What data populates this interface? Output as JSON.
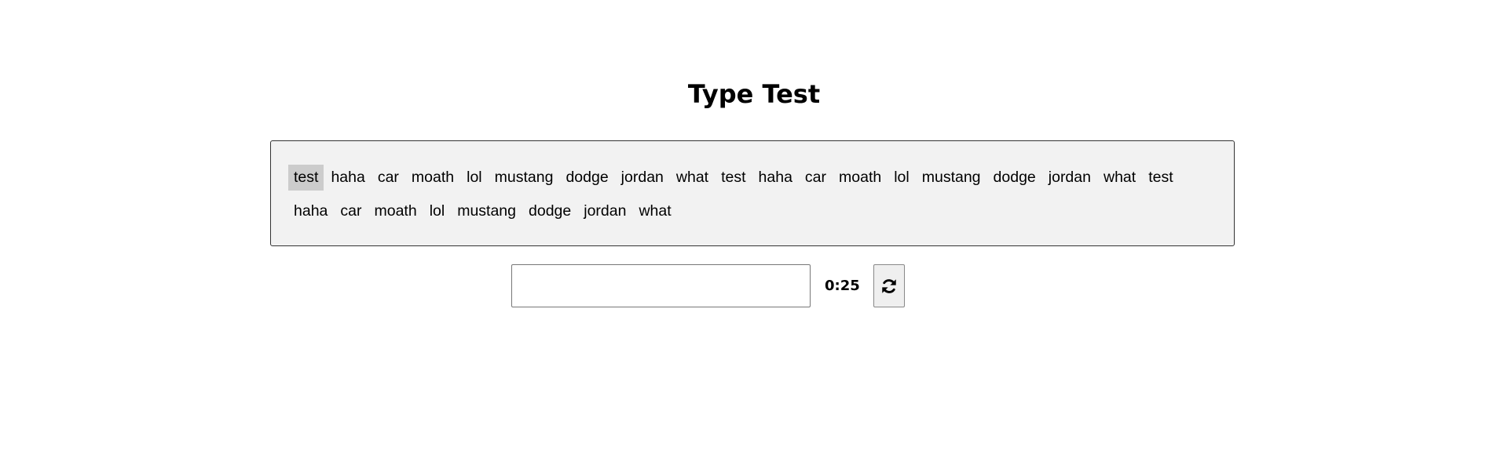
{
  "title": "Type Test",
  "words": [
    "test",
    "haha",
    "car",
    "moath",
    "lol",
    "mustang",
    "dodge",
    "jordan",
    "what",
    "test",
    "haha",
    "car",
    "moath",
    "lol",
    "mustang",
    "dodge",
    "jordan",
    "what",
    "test",
    "haha",
    "car",
    "moath",
    "lol",
    "mustang",
    "dodge",
    "jordan",
    "what"
  ],
  "current_word_index": 0,
  "input": {
    "value": "",
    "placeholder": ""
  },
  "timer": "0:25",
  "refresh_icon": "refresh-icon",
  "colors": {
    "box_bg": "#f2f2f2",
    "highlight": "#cccccc"
  }
}
